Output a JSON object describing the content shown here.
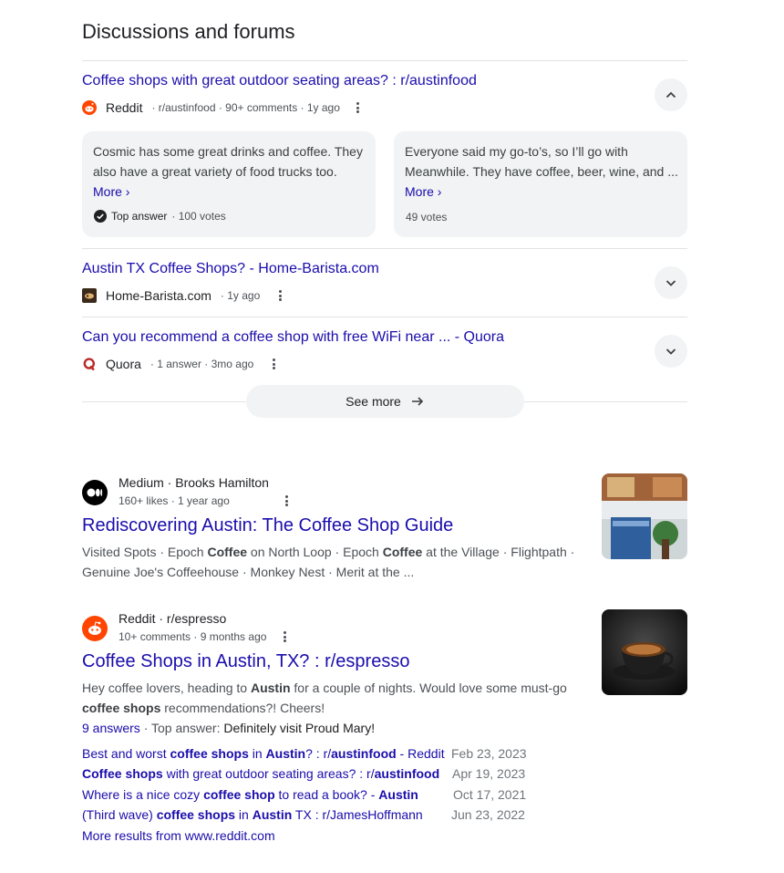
{
  "section_title": "Discussions and forums",
  "discussions": [
    {
      "title": "Coffee shops with great outdoor seating areas? : r/austinfood",
      "source": "Reddit",
      "meta": "· r/austinfood · 90+ comments · 1y ago",
      "answers": [
        {
          "text": "Cosmic has some great drinks and coffee. They also have a great variety of food trucks too.",
          "more": "More ›",
          "badge": "Top answer",
          "votes": "· 100 votes"
        },
        {
          "text": "Everyone said my go-to’s, so I’ll go with Meanwhile. They have coffee, beer, wine, and ...",
          "more": "More ›",
          "votes": "49 votes"
        }
      ]
    },
    {
      "title": "Austin TX Coffee Shops? - Home-Barista.com",
      "source": "Home-Barista.com",
      "meta": "· 1y ago"
    },
    {
      "title": "Can you recommend a coffee shop with free WiFi near ... - Quora",
      "source": "Quora",
      "meta": "· 1 answer · 3mo ago"
    }
  ],
  "see_more": "See more",
  "results": [
    {
      "source": "Medium · Brooks Hamilton",
      "meta": "160+ likes · 1 year ago",
      "title": "Rediscovering Austin: The Coffee Shop Guide",
      "snippet_l1_a": "Visited Spots · Epoch ",
      "snippet_l1_b": "Coffee",
      "snippet_l1_c": " on North Loop · Epoch ",
      "snippet_l1_d": "Coffee",
      "snippet_l1_e": " at the Village · Flightpath ·",
      "snippet_l2": "Genuine Joe's Coffeehouse · Monkey Nest · Merit at the ..."
    },
    {
      "source": "Reddit · r/espresso",
      "meta": "10+ comments · 9 months ago",
      "title": "Coffee Shops in Austin, TX? : r/espresso",
      "snippet_a": "Hey coffee lovers, heading to ",
      "snippet_b": "Austin",
      "snippet_c": " for a couple of nights. Would love some must-go",
      "snippet_d": "coffee shops",
      "snippet_e": " recommendations?! Cheers!",
      "answers_count": "9 answers",
      "top_answer_label": " · Top answer: ",
      "top_answer": "Definitely visit Proud Mary!",
      "sublinks": [
        {
          "a": "Best and worst ",
          "b": "coffee shops",
          "c": " in ",
          "d": "Austin",
          "e": "? : r/",
          "f": "austinfood",
          "g": " - Reddit",
          "date": "Feb 23, 2023"
        },
        {
          "a": "",
          "b": "Coffee shops",
          "c": " with great outdoor seating areas? : r/",
          "d": "austinfood",
          "e": "",
          "f": "",
          "g": "",
          "date": "Apr 19, 2023"
        },
        {
          "a": "Where is a nice cozy ",
          "b": "coffee shop",
          "c": " to read a book? - ",
          "d": "Austin",
          "e": "",
          "f": "",
          "g": "",
          "date": "Oct 17, 2021"
        },
        {
          "a": "(Third wave) ",
          "b": "coffee shops",
          "c": " in ",
          "d": "Austin",
          "e": " TX : r/JamesHoffmann",
          "f": "",
          "g": "",
          "date": "Jun 23, 2022"
        }
      ],
      "more_results": "More results from www.reddit.com"
    }
  ],
  "colors": {
    "link": "#1a0dab",
    "reddit": "#ff4500",
    "quora": "#b92b27"
  }
}
